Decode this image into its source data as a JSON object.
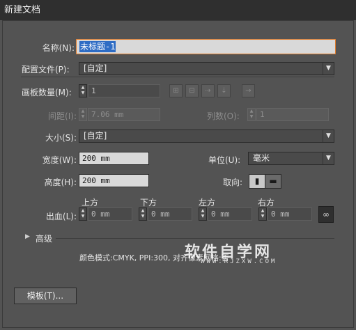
{
  "window": {
    "title": "新建文档"
  },
  "name": {
    "label": "名称(N):",
    "value": "未标题-1"
  },
  "profile": {
    "label": "配置文件(P):",
    "value": "[自定]"
  },
  "artboards": {
    "label": "画板数量(M):",
    "value": "1"
  },
  "spacing": {
    "label": "间距(I):",
    "value": "7.06 mm"
  },
  "columns": {
    "label": "列数(O):",
    "value": "1"
  },
  "size": {
    "label": "大小(S):",
    "value": "[自定]"
  },
  "width": {
    "label": "宽度(W):",
    "value": "200 mm"
  },
  "units": {
    "label": "单位(U):",
    "value": "毫米"
  },
  "height": {
    "label": "高度(H):",
    "value": "200 mm"
  },
  "orientation": {
    "label": "取向:"
  },
  "bleed": {
    "label": "出血(L):",
    "top": {
      "label": "上方",
      "value": "0 mm"
    },
    "bottom": {
      "label": "下方",
      "value": "0 mm"
    },
    "left": {
      "label": "左方",
      "value": "0 mm"
    },
    "right": {
      "label": "右方",
      "value": "0 mm"
    }
  },
  "advanced": {
    "label": "高级"
  },
  "info": {
    "text": "颜色模式:CMYK, PPI:300, 对齐像素网格:否"
  },
  "templates_button": {
    "label": "模板(T)..."
  },
  "watermark": {
    "title": "软件自学网",
    "url": "WWW.RJZXW.COM"
  },
  "icons": {
    "arrange_grid_row": "grid-by-row-icon",
    "arrange_grid_col": "grid-by-column-icon",
    "arrange_row": "arrange-by-row-icon",
    "arrange_col": "arrange-by-column-icon",
    "rtl": "right-to-left-icon",
    "link": "link-icon"
  }
}
